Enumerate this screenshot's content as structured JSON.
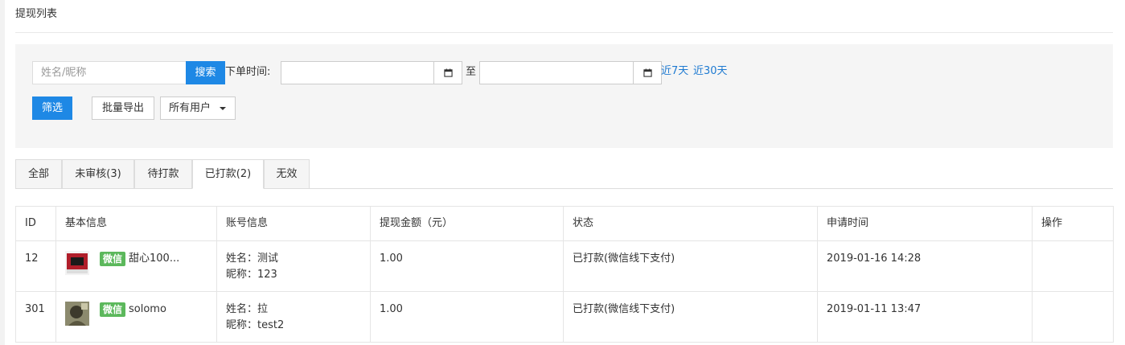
{
  "page": {
    "title": "提现列表"
  },
  "filter": {
    "search_placeholder": "姓名/昵称",
    "search_button": "搜索",
    "time_label": "下单时间:",
    "start_date": "",
    "end_date": "",
    "to_label": "至",
    "quick_7": "近7天",
    "quick_30": "近30天",
    "filter_button": "筛选",
    "export_button": "批量导出",
    "user_select": "所有用户"
  },
  "tabs": [
    {
      "label": "全部"
    },
    {
      "label": "未审核(3)"
    },
    {
      "label": "待打款"
    },
    {
      "label": "已打款(2)"
    },
    {
      "label": "无效"
    }
  ],
  "active_tab": "已打款(2)",
  "table": {
    "headers": [
      "ID",
      "基本信息",
      "账号信息",
      "提现金额（元）",
      "状态",
      "申请时间",
      "操作"
    ],
    "rows": [
      {
        "id": "12",
        "badge": "微信",
        "nickname": "甜心100...",
        "account_name": "姓名：测试",
        "account_nick": "昵称：123",
        "amount": "1.00",
        "status": "已打款(微信线下支付)",
        "time": "2019-01-16 14:28",
        "action": ""
      },
      {
        "id": "301",
        "badge": "微信",
        "nickname": "solomo",
        "account_name": "姓名：拉",
        "account_nick": "昵称：test2",
        "amount": "1.00",
        "status": "已打款(微信线下支付)",
        "time": "2019-01-11 13:47",
        "action": ""
      }
    ]
  },
  "colors": {
    "primary": "#1e88e5",
    "link": "#1e7ad1",
    "wechat_badge": "#5cb85c"
  }
}
